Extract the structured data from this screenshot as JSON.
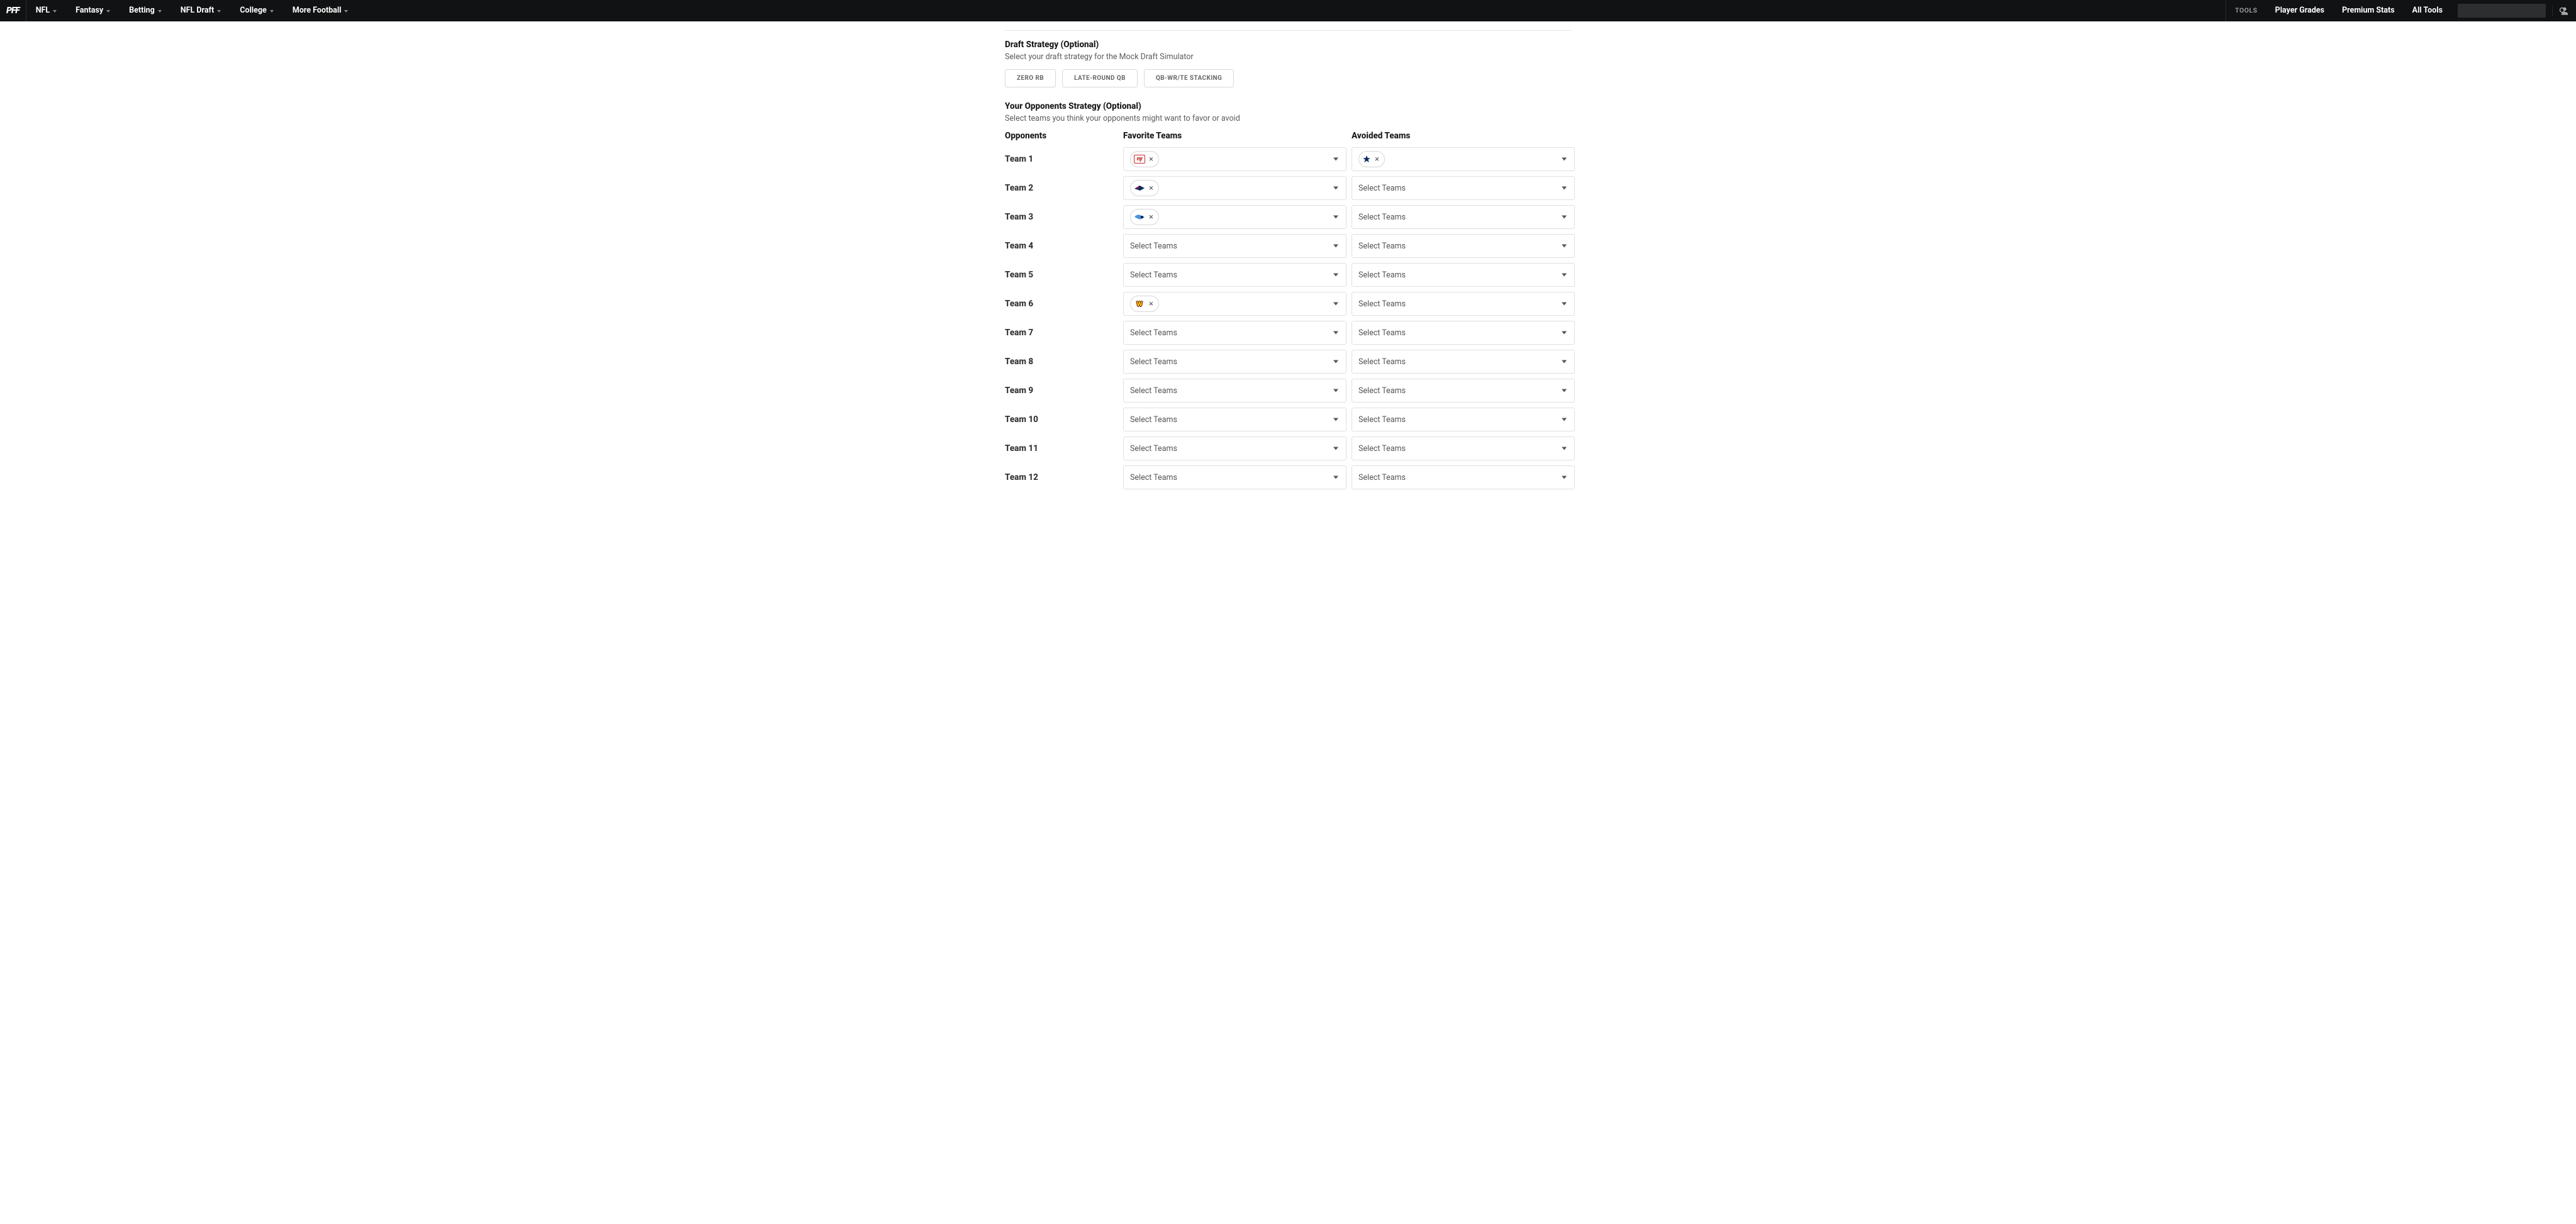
{
  "header": {
    "brand": "PFF",
    "nav_left": [
      "NFL",
      "Fantasy",
      "Betting",
      "NFL Draft",
      "College",
      "More Football"
    ],
    "tools_label": "TOOLS",
    "nav_right": [
      "Player Grades",
      "Premium Stats",
      "All Tools"
    ],
    "search_placeholder": ""
  },
  "draft_strategy": {
    "title": "Draft Strategy (Optional)",
    "subtitle": "Select your draft strategy for the Mock Draft Simulator",
    "options": [
      "ZERO RB",
      "LATE-ROUND QB",
      "QB-WR/TE STACKING"
    ]
  },
  "opponents_strategy": {
    "title": "Your Opponents Strategy (Optional)",
    "subtitle": "Select teams you think your opponents might want to favor or avoid",
    "col_opponents": "Opponents",
    "col_favorite": "Favorite Teams",
    "col_avoided": "Avoided Teams",
    "placeholder": "Select Teams",
    "rows": [
      {
        "name": "Team 1",
        "favorite_chips": [
          {
            "team": "nyg",
            "label": "NY"
          }
        ],
        "avoided_chips": [
          {
            "team": "dal",
            "label": "★"
          }
        ]
      },
      {
        "name": "Team 2",
        "favorite_chips": [
          {
            "team": "ne",
            "label": ""
          }
        ],
        "avoided_chips": []
      },
      {
        "name": "Team 3",
        "favorite_chips": [
          {
            "team": "ten",
            "label": ""
          }
        ],
        "avoided_chips": []
      },
      {
        "name": "Team 4",
        "favorite_chips": [],
        "avoided_chips": []
      },
      {
        "name": "Team 5",
        "favorite_chips": [],
        "avoided_chips": []
      },
      {
        "name": "Team 6",
        "favorite_chips": [
          {
            "team": "was",
            "label": "W"
          }
        ],
        "avoided_chips": []
      },
      {
        "name": "Team 7",
        "favorite_chips": [],
        "avoided_chips": []
      },
      {
        "name": "Team 8",
        "favorite_chips": [],
        "avoided_chips": []
      },
      {
        "name": "Team 9",
        "favorite_chips": [],
        "avoided_chips": []
      },
      {
        "name": "Team 10",
        "favorite_chips": [],
        "avoided_chips": []
      },
      {
        "name": "Team 11",
        "favorite_chips": [],
        "avoided_chips": []
      },
      {
        "name": "Team 12",
        "favorite_chips": [],
        "avoided_chips": []
      }
    ]
  }
}
